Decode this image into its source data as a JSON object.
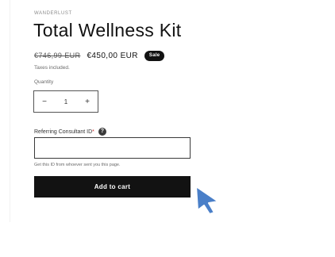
{
  "product": {
    "vendor": "WANDERLUST",
    "title": "Total Wellness Kit",
    "price_compare": "€746,99 EUR",
    "price_sale": "€450,00 EUR",
    "sale_badge": "Sale",
    "tax_note": "Taxes included."
  },
  "quantity": {
    "label": "Quantity",
    "minus_symbol": "−",
    "value": "1",
    "plus_symbol": "+"
  },
  "referral": {
    "label": "Referring Consultant ID",
    "required_mark": "*",
    "help_symbol": "?",
    "value": "",
    "hint": "Get this ID from whoever sent you this page."
  },
  "cart": {
    "add_label": "Add to cart"
  },
  "icons": {
    "help": "question-circle-icon",
    "cursor": "mouse-pointer-icon"
  },
  "colors": {
    "button_bg": "#121212",
    "cursor_fill": "#4a7fc8"
  }
}
